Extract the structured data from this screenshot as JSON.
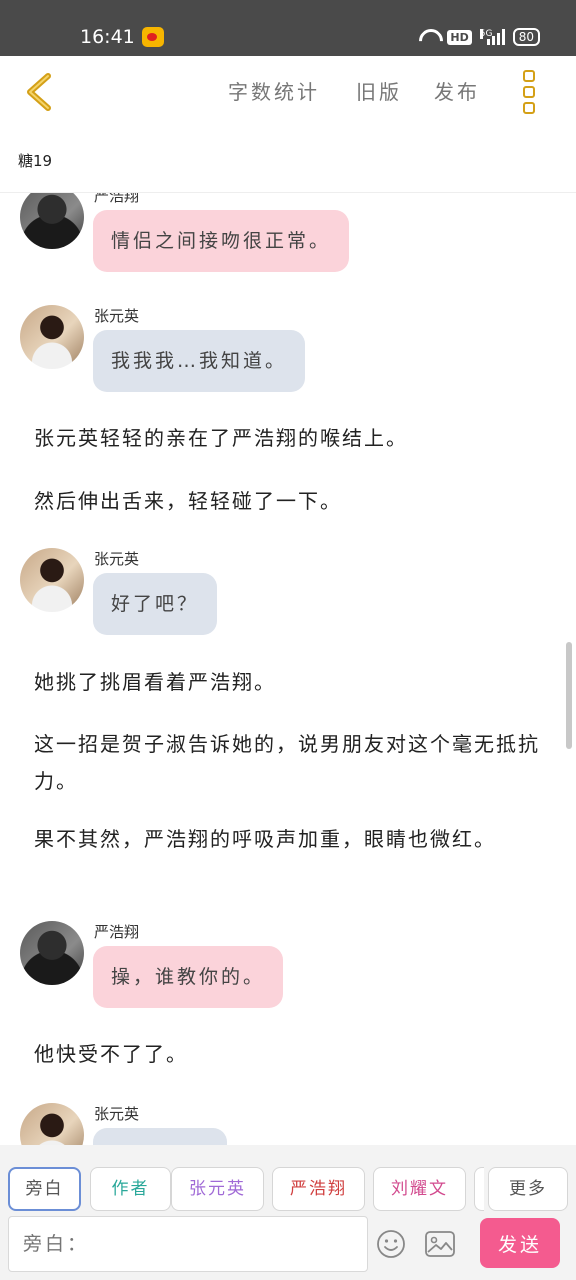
{
  "status_bar": {
    "time": "16:41",
    "network_label": "5G",
    "hd_label": "HD",
    "battery": "80"
  },
  "header": {
    "menu_stats": "字数统计",
    "menu_old": "旧版",
    "menu_publish": "发布",
    "chapter_title": "糖19",
    "accent_color": "#d4a017"
  },
  "messages": [
    {
      "sender": "严浩翔",
      "text": "情侣之间接吻很正常。"
    },
    {
      "sender": "张元英",
      "text": "我我我…我知道。"
    },
    {
      "narration": "张元英轻轻的亲在了严浩翔的喉结上。"
    },
    {
      "narration": "然后伸出舌来，轻轻碰了一下。"
    },
    {
      "sender": "张元英",
      "text": "好了吧？"
    },
    {
      "narration": "她挑了挑眉看着严浩翔。"
    },
    {
      "narration": "这一招是贺子淑告诉她的，说男朋友对这个毫无抵抗力。"
    },
    {
      "narration": "果不其然，严浩翔的呼吸声加重，眼睛也微红。"
    },
    {
      "sender": "严浩翔",
      "text": "操，谁教你的。"
    },
    {
      "narration": "他快受不了了。"
    },
    {
      "sender": "张元英",
      "text": ""
    }
  ],
  "role_bar": {
    "narration": "旁白",
    "author": "作者",
    "zhang": "张元英",
    "yan": "严浩翔",
    "liu": "刘耀文",
    "more": "更多"
  },
  "composer": {
    "placeholder": "旁白：",
    "send_label": "发送",
    "send_color": "#f45b8f"
  }
}
